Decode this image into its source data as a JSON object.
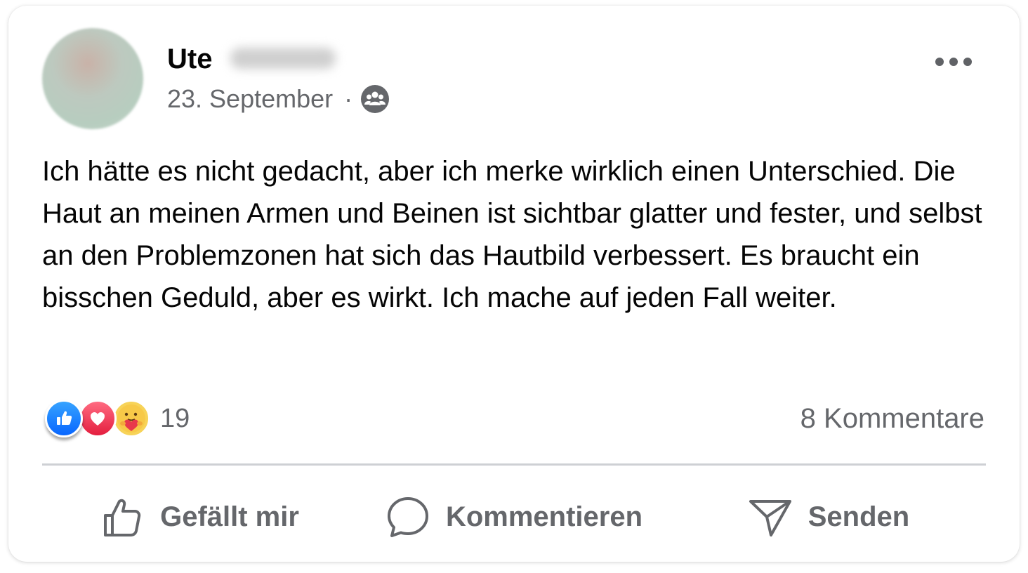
{
  "post": {
    "author_first_name": "Ute",
    "date": "23. September",
    "separator": "·",
    "audience_icon": "friends-icon",
    "more_icon": "more-options-icon",
    "text": "Ich hätte es nicht gedacht, aber ich merke wirklich einen Unterschied. Die Haut an meinen Armen und Beinen ist sichtbar glatter und fester, und selbst an den Problemzonen hat sich das Hautbild verbessert. Es braucht ein bisschen Geduld, aber es wirkt. Ich mache auf jeden Fall weiter."
  },
  "engagement": {
    "reactions": [
      "like",
      "love",
      "care"
    ],
    "reaction_count": "19",
    "comments_label": "8 Kommentare"
  },
  "actions": {
    "like_label": "Gefällt mir",
    "comment_label": "Kommentieren",
    "send_label": "Senden"
  },
  "colors": {
    "text_primary": "#050505",
    "text_secondary": "#65676b",
    "like_blue": "#0866ff",
    "love_red": "#e41e3f",
    "care_yellow": "#f7d358",
    "divider": "#ced0d4"
  }
}
